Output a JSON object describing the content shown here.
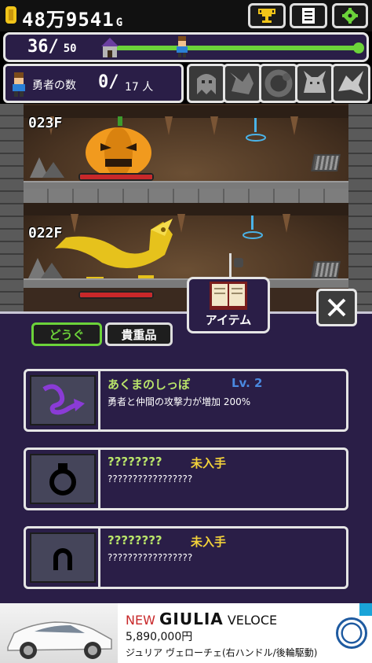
{
  "header": {
    "gold_value": "48万9541",
    "gold_unit": "G",
    "alert_mark": "!",
    "buttons": {
      "trophy": "trophy-icon",
      "notes": "notes-icon",
      "settings": "gear-icon"
    }
  },
  "floor_progress": {
    "current": "36",
    "separator": "/",
    "max": "50",
    "progress_fraction": 0.72
  },
  "heroes": {
    "label": "勇者の数",
    "count": "0",
    "separator": "/",
    "max": "17 人"
  },
  "bosses": [
    "ghost-boss-icon",
    "dragon-boss-icon",
    "serpent-boss-icon",
    "wolf-boss-icon",
    "bird-boss-icon"
  ],
  "dungeon": {
    "rooms": [
      {
        "floor": "023F",
        "monster": "pumpkin-monster-icon",
        "hp_fraction": 1.0
      },
      {
        "floor": "022F",
        "monster": "golden-dragon-monster-icon",
        "hp_fraction": 1.0
      }
    ]
  },
  "panel": {
    "item_tab_label": "アイテム",
    "close_icon": "close-icon",
    "tabs": [
      {
        "label": "どうぐ",
        "active": true
      },
      {
        "label": "貴重品",
        "active": false
      }
    ],
    "items": [
      {
        "name": "あくまのしっぽ",
        "level": "Lv. 2",
        "status": "",
        "description": "勇者と仲間の攻撃力が増加 200%",
        "icon": "devil-tail-icon"
      },
      {
        "name": "????????",
        "level": "",
        "status": "未入手",
        "description": "?????????????????",
        "icon": "ring-icon"
      },
      {
        "name": "????????",
        "level": "",
        "status": "未入手",
        "description": "?????????????????",
        "icon": "horseshoe-icon"
      }
    ]
  },
  "ad": {
    "new_label": "NEW",
    "model": "GIULIA",
    "variant": "VELOCE",
    "price": "5,890,000円",
    "description": "ジュリア ヴェローチェ(右ハンドル/後輪駆動)"
  },
  "colors": {
    "panel_bg": "#2a1e47",
    "active_tab": "#6cd33a",
    "item_name": "#b9e46a",
    "level_text": "#4a89e0",
    "status_text": "#f3d23a",
    "hp_red": "#c8282a"
  }
}
